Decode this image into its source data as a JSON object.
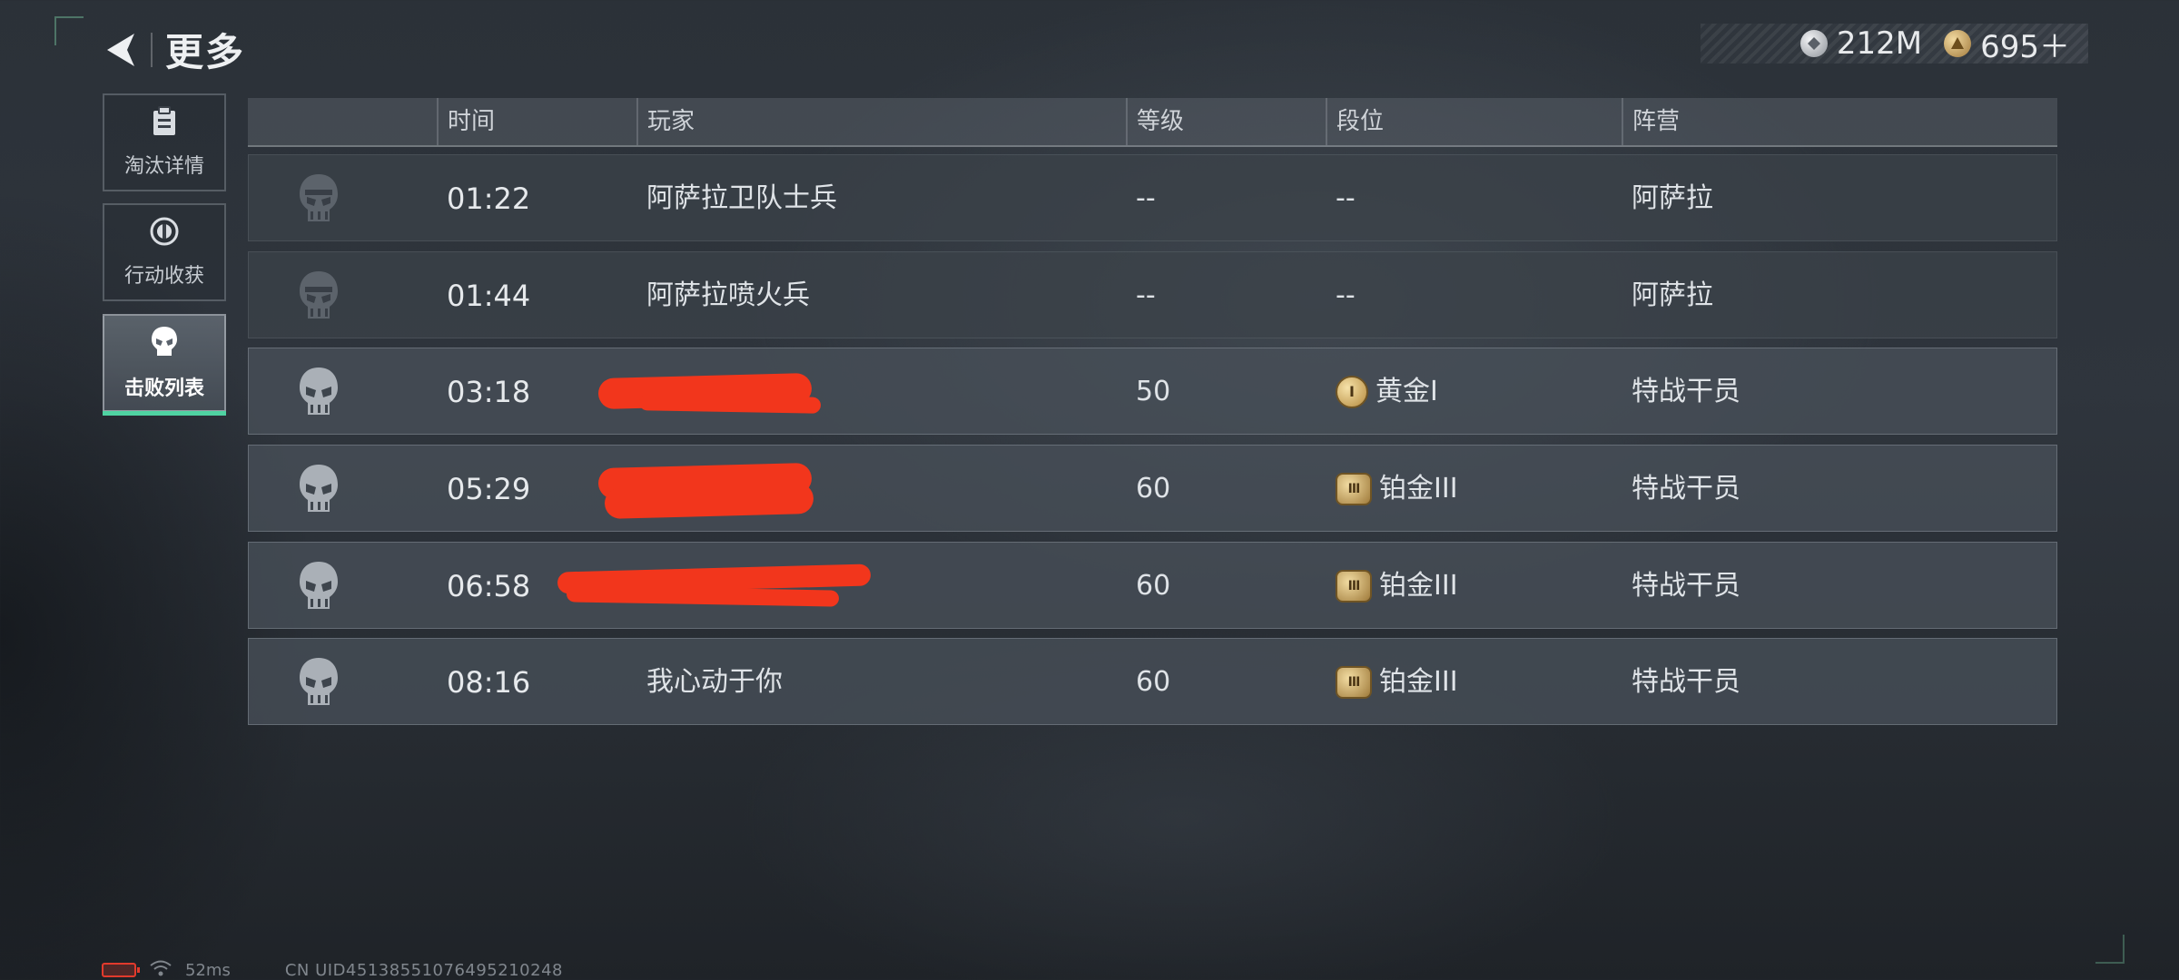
{
  "header": {
    "title": "更多",
    "currency": [
      {
        "icon": "silver-coin-icon",
        "value": "212M"
      },
      {
        "icon": "gold-coin-icon",
        "value": "695＋"
      }
    ]
  },
  "sidebar": {
    "tabs": [
      {
        "label": "淘汰详情",
        "icon": "clipboard-icon",
        "active": false
      },
      {
        "label": "行动收获",
        "icon": "loot-icon",
        "active": false
      },
      {
        "label": "击败列表",
        "icon": "skull-icon",
        "active": true
      }
    ]
  },
  "table": {
    "columns": [
      "时间",
      "玩家",
      "等级",
      "段位",
      "阵营"
    ],
    "rows": [
      {
        "time": "01:22",
        "player": "阿萨拉卫队士兵",
        "level": "--",
        "rank": "--",
        "rank_icon": null,
        "faction": "阿萨拉"
      },
      {
        "time": "01:44",
        "player": "阿萨拉喷火兵",
        "level": "--",
        "rank": "--",
        "rank_icon": null,
        "faction": "阿萨拉"
      },
      {
        "time": "03:18",
        "player": "",
        "level": "50",
        "rank": "黄金I",
        "rank_icon": "I",
        "faction": "特战干员"
      },
      {
        "time": "05:29",
        "player": "",
        "level": "60",
        "rank": "铂金III",
        "rank_icon": "III",
        "faction": "特战干员"
      },
      {
        "time": "06:58",
        "player": "",
        "level": "60",
        "rank": "铂金III",
        "rank_icon": "III",
        "faction": "特战干员"
      },
      {
        "time": "08:16",
        "player": "我心动于你",
        "level": "60",
        "rank": "铂金III",
        "rank_icon": "III",
        "faction": "特战干员"
      }
    ]
  },
  "status": {
    "ping": "52ms",
    "uid": "CN UID4513855107649521024​8"
  },
  "colors": {
    "accent": "#4fd3a2",
    "redaction": "#f2361c"
  }
}
